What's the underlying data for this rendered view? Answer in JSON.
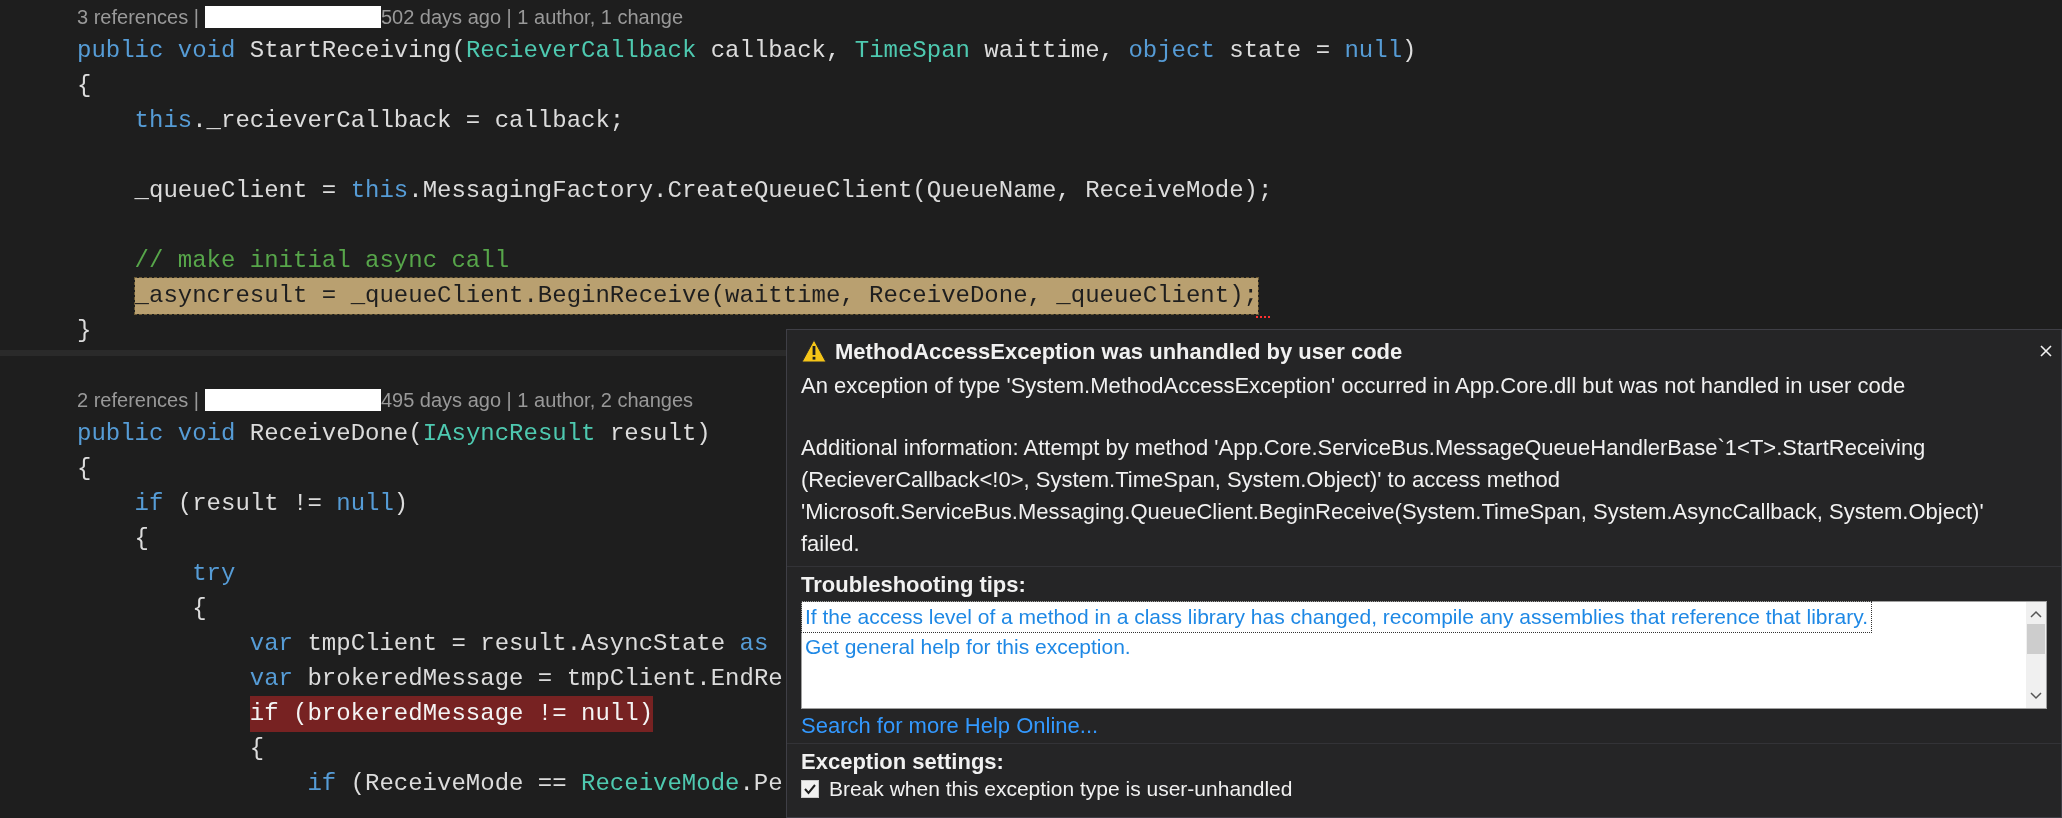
{
  "editor": {
    "methods": [
      {
        "codelens": {
          "references": "3 references |",
          "redacted": true,
          "history": "502 days ago | 1 author, 1 change"
        },
        "lines": [
          {
            "kind": "code",
            "tokens": [
              {
                "kind": "keyword",
                "text": "public void"
              },
              {
                "kind": "plain",
                "text": "StartReceiving("
              },
              {
                "kind": "type",
                "text": "RecieverCallback"
              },
              {
                "kind": "plain",
                "text": "callback,"
              },
              {
                "kind": "type",
                "text": "TimeSpan"
              },
              {
                "kind": "plain",
                "text": "waittime,"
              },
              {
                "kind": "keyword",
                "text": "object"
              },
              {
                "kind": "plain",
                "text": "state ="
              },
              {
                "kind": "keyword",
                "text": "null"
              },
              {
                "kind": "punct",
                "text": ")"
              }
            ]
          },
          {
            "kind": "code",
            "tokens": [
              {
                "kind": "plain",
                "text": "{"
              }
            ],
            "children": [
              {
                "kind": "code",
                "tokens": [
                  {
                    "kind": "keyword",
                    "text": "this"
                  },
                  {
                    "kind": "punct",
                    "text": "._recieverCallback = callback;"
                  }
                ]
              },
              {
                "kind": "blank"
              },
              {
                "kind": "code",
                "tokens": [
                  {
                    "kind": "plain",
                    "text": "_queueClient ="
                  },
                  {
                    "kind": "keyword",
                    "text": "this"
                  },
                  {
                    "kind": "punct",
                    "text": ".MessagingFactory.CreateQueueClient(QueueName, ReceiveMode);"
                  }
                ]
              },
              {
                "kind": "blank"
              },
              {
                "kind": "code",
                "tokens": [
                  {
                    "kind": "comment",
                    "text": "// make initial async call"
                  }
                ]
              },
              {
                "kind": "code",
                "current_statement": true,
                "tokens": [
                  {
                    "kind": "plain",
                    "text": "_asyncresult = _queueClient.BeginReceive(waittime, ReceiveDone, _queueClient);"
                  }
                ]
              }
            ]
          },
          {
            "kind": "code",
            "tokens": [
              {
                "kind": "plain",
                "text": "}"
              }
            ]
          }
        ]
      },
      {
        "codelens": {
          "references": "2 references |",
          "redacted": true,
          "history": "495 days ago | 1 author, 2 changes"
        },
        "lines": [
          {
            "kind": "code",
            "tokens": [
              {
                "kind": "keyword",
                "text": "public void"
              },
              {
                "kind": "plain",
                "text": "ReceiveDone("
              },
              {
                "kind": "type",
                "text": "IAsyncResult"
              },
              {
                "kind": "plain",
                "text": "result)"
              }
            ]
          },
          {
            "kind": "code",
            "tokens": [
              {
                "kind": "plain",
                "text": "{"
              }
            ],
            "children": [
              {
                "kind": "code",
                "tokens": [
                  {
                    "kind": "keyword",
                    "text": "if"
                  },
                  {
                    "kind": "plain",
                    "text": "(result !="
                  },
                  {
                    "kind": "keyword",
                    "text": "null"
                  },
                  {
                    "kind": "punct",
                    "text": ")"
                  }
                ]
              },
              {
                "kind": "code",
                "tokens": [
                  {
                    "kind": "plain",
                    "text": "{"
                  }
                ],
                "children": [
                  {
                    "kind": "code",
                    "tokens": [
                      {
                        "kind": "keyword",
                        "text": "try"
                      }
                    ]
                  },
                  {
                    "kind": "code",
                    "tokens": [
                      {
                        "kind": "plain",
                        "text": "{"
                      }
                    ],
                    "children": [
                      {
                        "kind": "code",
                        "tokens": [
                          {
                            "kind": "keyword",
                            "text": "var"
                          },
                          {
                            "kind": "plain",
                            "text": "tmpClient = result.AsyncState"
                          },
                          {
                            "kind": "keyword",
                            "text": "as"
                          }
                        ]
                      },
                      {
                        "kind": "code",
                        "tokens": [
                          {
                            "kind": "keyword",
                            "text": "var"
                          },
                          {
                            "kind": "plain",
                            "text": "brokeredMessage = tmpClient.EndRe"
                          }
                        ]
                      },
                      {
                        "kind": "code",
                        "breakpoint": true,
                        "tokens": [
                          {
                            "kind": "plain",
                            "text": "if (brokeredMessage != null)"
                          }
                        ]
                      },
                      {
                        "kind": "code",
                        "tokens": [
                          {
                            "kind": "plain",
                            "text": "{"
                          }
                        ],
                        "children": [
                          {
                            "kind": "code",
                            "tokens": [
                              {
                                "kind": "keyword",
                                "text": "if"
                              },
                              {
                                "kind": "plain",
                                "text": "(ReceiveMode =="
                              },
                              {
                                "kind": "type",
                                "text": "ReceiveMode"
                              },
                              {
                                "kind": "punct",
                                "text": ".Pe"
                              }
                            ]
                          }
                        ]
                      }
                    ]
                  }
                ]
              }
            ]
          }
        ]
      }
    ]
  },
  "exception_dialog": {
    "title": "MethodAccessException was unhandled by user code",
    "message": [
      "An exception of type 'System.MethodAccessException' occurred in App.Core.dll but was not handled in user code",
      "Additional information: Attempt by method 'App.Core.ServiceBus.MessageQueueHandlerBase`1<T>.StartReceiving (RecieverCallback<!0>, System.TimeSpan, System.Object)' to access method 'Microsoft.ServiceBus.Messaging.QueueClient.BeginReceive(System.TimeSpan, System.AsyncCallback, System.Object)' failed."
    ],
    "tips_heading": "Troubleshooting tips:",
    "tips": [
      {
        "text": "If the access level of a method in a class library has changed, recompile any assemblies that reference that library.",
        "selected": true
      },
      {
        "text": "Get general help for this exception.",
        "selected": false
      }
    ],
    "help_link": "Search for more Help Online...",
    "settings_heading": "Exception settings:",
    "settings": [
      {
        "label": "Break when this exception type is user-unhandled",
        "checked": true
      }
    ]
  }
}
